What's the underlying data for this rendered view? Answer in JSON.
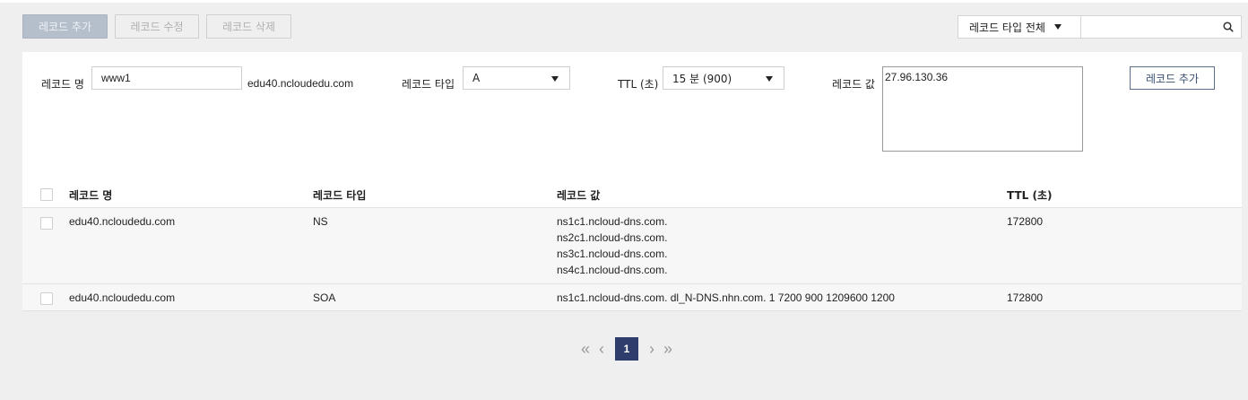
{
  "toolbar": {
    "add_record": "레코드 추가",
    "edit_record": "레코드 수정",
    "delete_record": "레코드 삭제"
  },
  "filter": {
    "type_selected": "레코드 타입 전체",
    "search_placeholder": ""
  },
  "form": {
    "record_name_label": "레코드 명",
    "record_name_value": "www1",
    "domain_suffix": "edu40.ncloudedu.com",
    "record_type_label": "레코드 타입",
    "record_type_value": "A",
    "ttl_label": "TTL (초)",
    "ttl_value": "15 분 (900)",
    "record_value_label": "레코드 값",
    "record_value_value": "27.96.130.36",
    "add_button": "레코드 추가"
  },
  "table": {
    "headers": {
      "name": "레코드 명",
      "type": "레코드 타입",
      "value": "레코드 값",
      "ttl": "TTL (초)"
    },
    "rows": [
      {
        "name": "edu40.ncloudedu.com",
        "type": "NS",
        "values": [
          "ns1c1.ncloud-dns.com.",
          "ns2c1.ncloud-dns.com.",
          "ns3c1.ncloud-dns.com.",
          "ns4c1.ncloud-dns.com."
        ],
        "ttl": "172800"
      },
      {
        "name": "edu40.ncloudedu.com",
        "type": "SOA",
        "values": [
          "ns1c1.ncloud-dns.com. dl_N-DNS.nhn.com. 1 7200 900 1209600 1200"
        ],
        "ttl": "172800"
      }
    ]
  },
  "pagination": {
    "current_page": "1",
    "first": "«",
    "prev": "‹",
    "next": "›",
    "last": "»"
  },
  "colors": {
    "accent": "#2e3d6b",
    "primary_disabled": "#b5bfcc",
    "background": "#efefef"
  }
}
